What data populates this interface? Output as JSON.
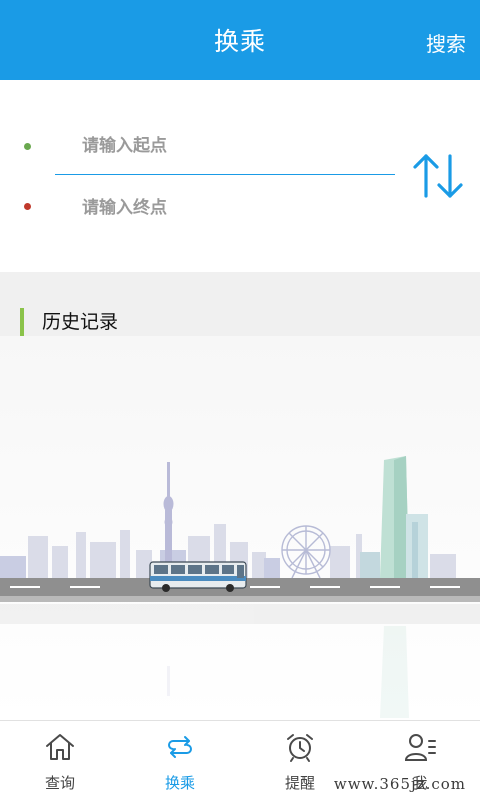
{
  "header": {
    "title": "换乘",
    "search_label": "搜索"
  },
  "route_form": {
    "start_placeholder": "请输入起点",
    "end_placeholder": "请输入终点",
    "swap_icon": "swap-vertical-icon"
  },
  "history": {
    "title": "历史记录"
  },
  "tabs": [
    {
      "label": "查询",
      "icon": "home-icon",
      "active": false
    },
    {
      "label": "换乘",
      "icon": "transfer-icon",
      "active": true
    },
    {
      "label": "提醒",
      "icon": "alarm-clock-icon",
      "active": false
    },
    {
      "label": "我",
      "icon": "profile-list-icon",
      "active": false
    }
  ],
  "watermark": "www.365jz.com",
  "colors": {
    "brand": "#1a9be6",
    "start_dot": "#6aa84f",
    "end_dot": "#c0392b",
    "history_accent": "#8bc34a"
  }
}
